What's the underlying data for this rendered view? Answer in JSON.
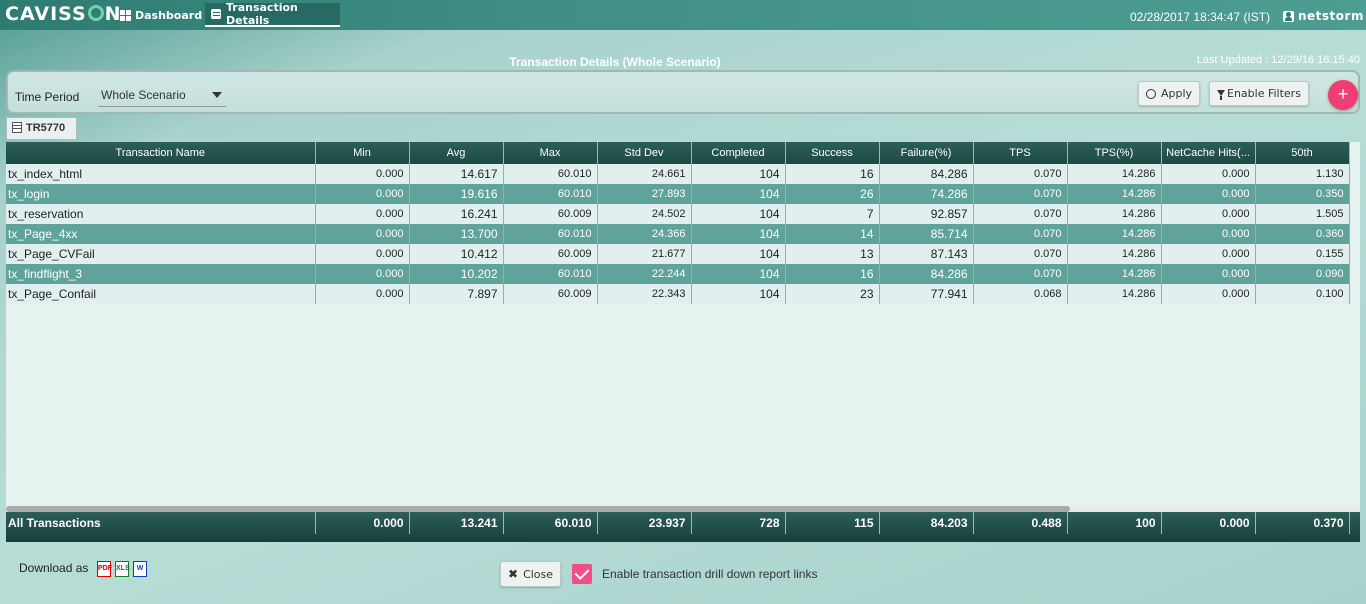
{
  "app": {
    "logo_left": "CAVISS",
    "logo_right": "N"
  },
  "nav": {
    "dashboard": "Dashboard",
    "transaction_details": "Transaction Details"
  },
  "header": {
    "datetime": "02/28/2017 18:34:47 (IST)",
    "user": "netstorm"
  },
  "page": {
    "title": "Transaction Details (Whole Scenario)",
    "last_updated": "Last Updated : 12/29/16 16:15:40"
  },
  "filter": {
    "time_period_label": "Time Period",
    "time_period_value": "Whole Scenario",
    "apply": "Apply",
    "enable_filters": "Enable Filters",
    "add": "+"
  },
  "tab": {
    "label": "TR5770"
  },
  "table": {
    "columns": [
      "Transaction Name",
      "Min",
      "Avg",
      "Max",
      "Std Dev",
      "Completed",
      "Success",
      "Failure(%)",
      "TPS",
      "TPS(%)",
      "NetCache Hits(...",
      "50th"
    ],
    "rows": [
      [
        "tx_index_html",
        "0.000",
        "14.617",
        "60.010",
        "24.661",
        "104",
        "16",
        "84.286",
        "0.070",
        "14.286",
        "0.000",
        "1.130"
      ],
      [
        "tx_login",
        "0.000",
        "19.616",
        "60.010",
        "27.893",
        "104",
        "26",
        "74.286",
        "0.070",
        "14.286",
        "0.000",
        "0.350"
      ],
      [
        "tx_reservation",
        "0.000",
        "16.241",
        "60.009",
        "24.502",
        "104",
        "7",
        "92.857",
        "0.070",
        "14.286",
        "0.000",
        "1.505"
      ],
      [
        "tx_Page_4xx",
        "0.000",
        "13.700",
        "60.010",
        "24.366",
        "104",
        "14",
        "85.714",
        "0.070",
        "14.286",
        "0.000",
        "0.360"
      ],
      [
        "tx_Page_CVFail",
        "0.000",
        "10.412",
        "60.009",
        "21.677",
        "104",
        "13",
        "87.143",
        "0.070",
        "14.286",
        "0.000",
        "0.155"
      ],
      [
        "tx_findflight_3",
        "0.000",
        "10.202",
        "60.010",
        "22.244",
        "104",
        "16",
        "84.286",
        "0.070",
        "14.286",
        "0.000",
        "0.090"
      ],
      [
        "tx_Page_Confail",
        "0.000",
        "7.897",
        "60.009",
        "22.343",
        "104",
        "23",
        "77.941",
        "0.068",
        "14.286",
        "0.000",
        "0.100"
      ]
    ],
    "totals": [
      "All Transactions",
      "0.000",
      "13.241",
      "60.010",
      "23.937",
      "728",
      "115",
      "84.203",
      "0.488",
      "100",
      "0.000",
      "0.370"
    ]
  },
  "footer": {
    "download_as": "Download as",
    "pdf": "PDF",
    "xls": "XLS",
    "doc": "W",
    "close": "Close",
    "drill_down": "Enable transaction drill down report links"
  },
  "colors": {
    "accent": "#ee3e73",
    "header_dark": "#1d4a45",
    "row_alt": "#5fa39a"
  }
}
